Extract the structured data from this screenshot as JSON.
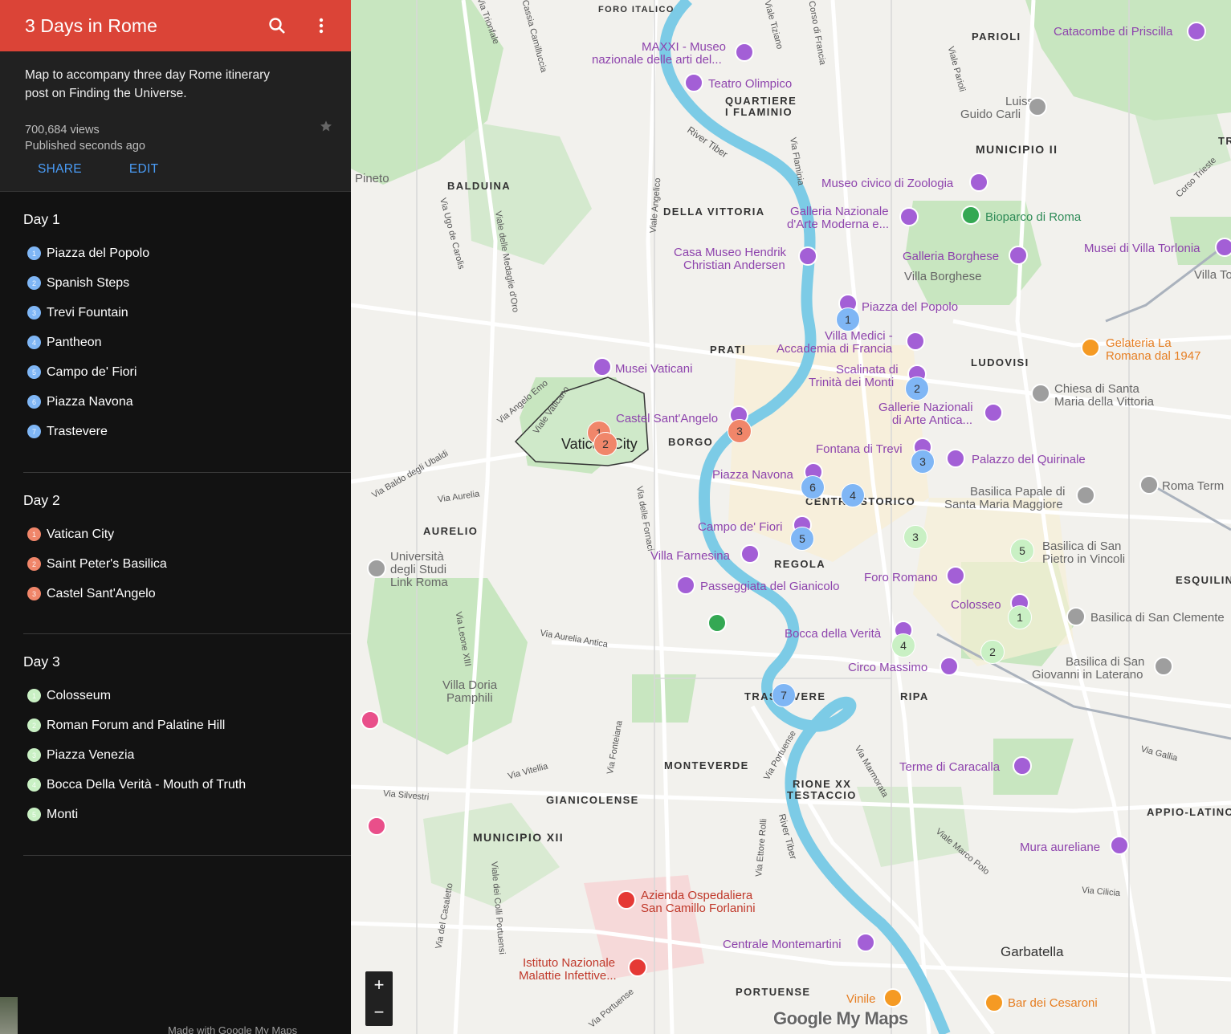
{
  "header": {
    "title": "3 Days in Rome"
  },
  "info": {
    "description": "Map to accompany three day Rome itinerary post on Finding the Universe.",
    "views": "700,684 views",
    "published": "Published seconds ago",
    "share_label": "SHARE",
    "edit_label": "EDIT"
  },
  "days": [
    {
      "title": "Day 1",
      "color": "#7fb6f5",
      "items": [
        {
          "num": "1",
          "label": "Piazza del Popolo"
        },
        {
          "num": "2",
          "label": "Spanish Steps"
        },
        {
          "num": "3",
          "label": "Trevi Fountain"
        },
        {
          "num": "4",
          "label": "Pantheon"
        },
        {
          "num": "5",
          "label": "Campo de' Fiori"
        },
        {
          "num": "6",
          "label": "Piazza Navona"
        },
        {
          "num": "7",
          "label": "Trastevere"
        }
      ]
    },
    {
      "title": "Day 2",
      "color": "#f0866a",
      "items": [
        {
          "num": "1",
          "label": "Vatican City"
        },
        {
          "num": "2",
          "label": "Saint Peter's Basilica"
        },
        {
          "num": "3",
          "label": "Castel Sant'Angelo"
        }
      ]
    },
    {
      "title": "Day 3",
      "color": "#c9f0c4",
      "items": [
        {
          "num": "1",
          "label": "Colosseum"
        },
        {
          "num": "2",
          "label": "Roman Forum and Palatine Hill"
        },
        {
          "num": "3",
          "label": "Piazza Venezia"
        },
        {
          "num": "4",
          "label": "Bocca Della Verità - Mouth of Truth"
        },
        {
          "num": "5",
          "label": "Monti"
        }
      ]
    }
  ],
  "footer": {
    "made_with": "Made with Google My Maps"
  },
  "map": {
    "districts": [
      "FORO ITALICO",
      "PARIOLI",
      "QUARTIERE",
      "I FLAMINIO",
      "MUNICIPIO II",
      "BALDUINA",
      "DELLA VITTORIA",
      "PRATI",
      "LUDOVISI",
      "BORGO",
      "AURELIO",
      "CENTRO STORICO",
      "REGOLA",
      "ESQUILINO",
      "TRASTEVERE",
      "RIPA",
      "MONTEVERDE",
      "RIONE XX",
      "TESTACCIO",
      "GIANICOLENSE",
      "APPIO-LATINO",
      "MUNICIPIO XII",
      "PORTUENSE",
      "Garbatella",
      "TR"
    ],
    "pois": [
      "MAXXI - Museo",
      "nazionale delle arti del...",
      "Teatro Olimpico",
      "Luiss",
      "Guido Carli",
      "Catacombe di Priscilla",
      "Museo civico di Zoologia",
      "Galleria Nazionale",
      "d'Arte Moderna e...",
      "Bioparco di Roma",
      "Casa Museo Hendrik",
      "Christian Andersen",
      "Galleria Borghese",
      "Villa Borghese",
      "Musei di Villa Torlonia",
      "Villa To",
      "Piazza del Popolo",
      "Villa Medici -",
      "Accademia di Francia",
      "Gelateria La",
      "Romana dal 1947",
      "Scalinata di",
      "Trinità dei Monti",
      "Musei Vaticani",
      "Chiesa di Santa",
      "Maria della Vittoria",
      "Castel Sant'Angelo",
      "Gallerie Nazionali",
      "di Arte Antica...",
      "Vatican City",
      "Fontana di Trevi",
      "Palazzo del Quirinale",
      "Piazza Navona",
      "Roma Term",
      "Basilica Papale di",
      "Santa Maria Maggiore",
      "Campo de' Fiori",
      "Università",
      "degli Studi",
      "Link Roma",
      "Basilica di San",
      "Pietro in Vincoli",
      "Villa Farnesina",
      "Foro Romano",
      "Passeggiata del Gianicolo",
      "Colosseo",
      "Basilica di San Clemente",
      "Bocca della Verità",
      "Circo Massimo",
      "Basilica di San",
      "Giovanni in Laterano",
      "Villa Doria",
      "Pamphili",
      "Terme di Caracalla",
      "Mura aureliane",
      "Azienda Ospedaliera",
      "San Camillo Forlanini",
      "Centrale Montemartini",
      "Istituto Nazionale",
      "Malattie Infettive...",
      "Vinile",
      "Bar dei Cesaroni",
      "Pineto"
    ],
    "streets": [
      "Via Trionfale",
      "Via Cassia Camilluccia",
      "Viale Tiziano",
      "Corso di Francia",
      "Viale Parioli",
      "Corso Trieste",
      "Via Flaminia",
      "River Tiber",
      "Viale Angelico",
      "Via Ugo de Carolis",
      "Viale delle Medaglie d'Oro",
      "Via Angelo Emo",
      "Viale Vaticano",
      "Via Baldo degli Ubaldi",
      "Via Aurelia",
      "Via delle Fornaci",
      "Via Aurelia Antica",
      "Via Leone XIII",
      "Via Fonteiana",
      "Via Vitellia",
      "Via Silvestri",
      "Via Portuense",
      "Via Marmorata",
      "River Tiber",
      "Via Ettore Rolli",
      "Viale Marco Polo",
      "Via Cilicia",
      "Via Gallia",
      "Via del Casaletto",
      "Viale dei Colli Portuensi",
      "Via Portuense"
    ],
    "zoom_in": "+",
    "zoom_out": "−",
    "logo": "Google My Maps"
  }
}
